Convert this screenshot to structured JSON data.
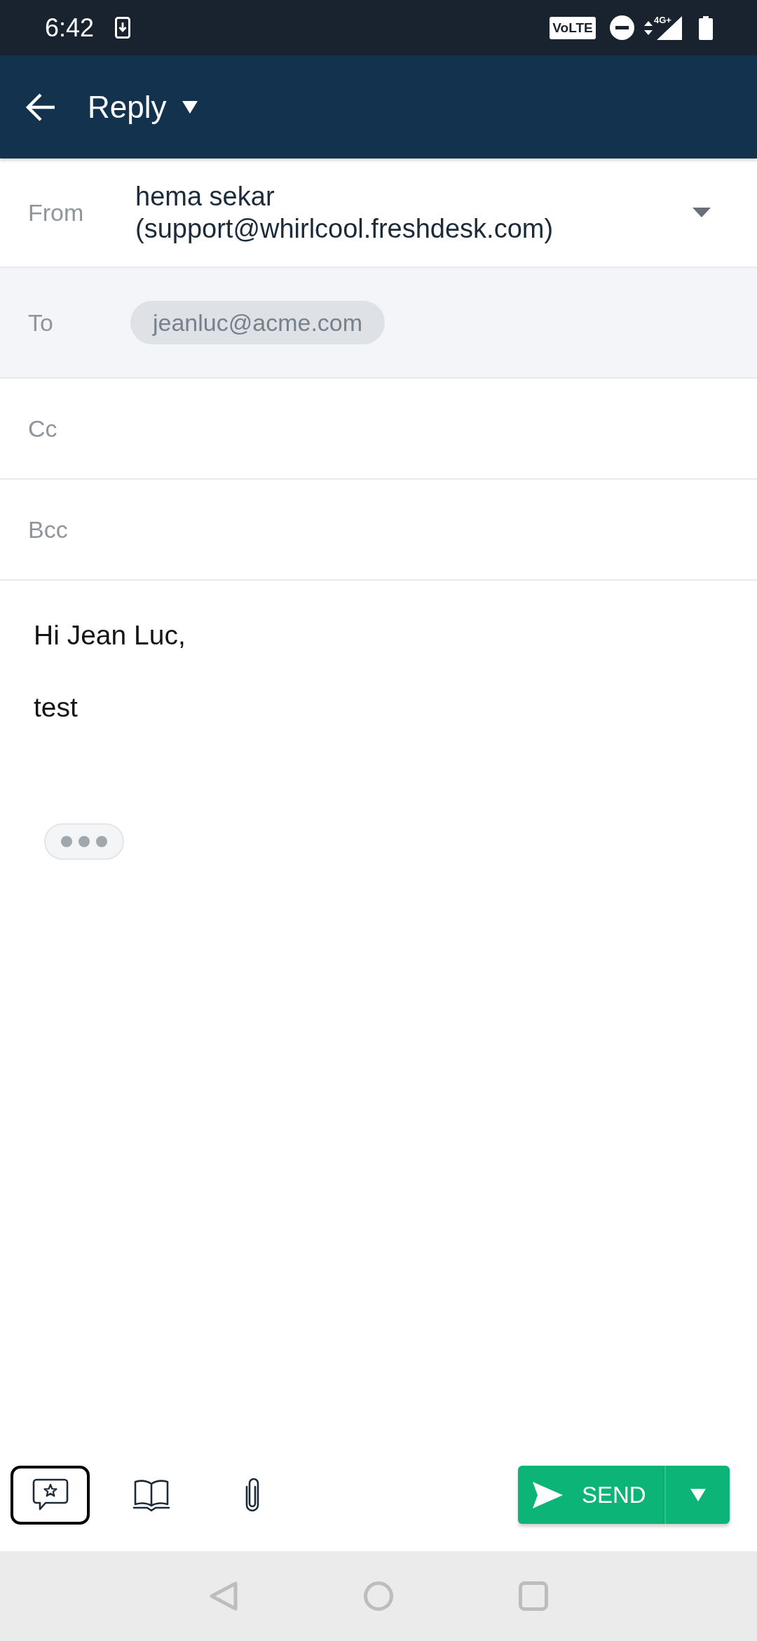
{
  "status_bar": {
    "time": "6:42",
    "volte": "VoLTE",
    "network": "4G+"
  },
  "header": {
    "title": "Reply"
  },
  "from": {
    "label": "From",
    "name": "hema sekar",
    "email": "(support@whirlcool.freshdesk.com)"
  },
  "recipients": [
    {
      "label": "To",
      "active": true,
      "chips": [
        "jeanluc@acme.com"
      ]
    },
    {
      "label": "Cc",
      "active": false
    },
    {
      "label": "Bcc",
      "active": false
    }
  ],
  "body": {
    "lines": [
      "Hi Jean Luc,",
      "test"
    ]
  },
  "toolbar": {
    "tools": [
      {
        "kind": "canned",
        "selected": true
      },
      {
        "kind": "solutions",
        "selected": false
      },
      {
        "kind": "attach",
        "selected": false
      }
    ],
    "send": {
      "label": "SEND"
    }
  }
}
